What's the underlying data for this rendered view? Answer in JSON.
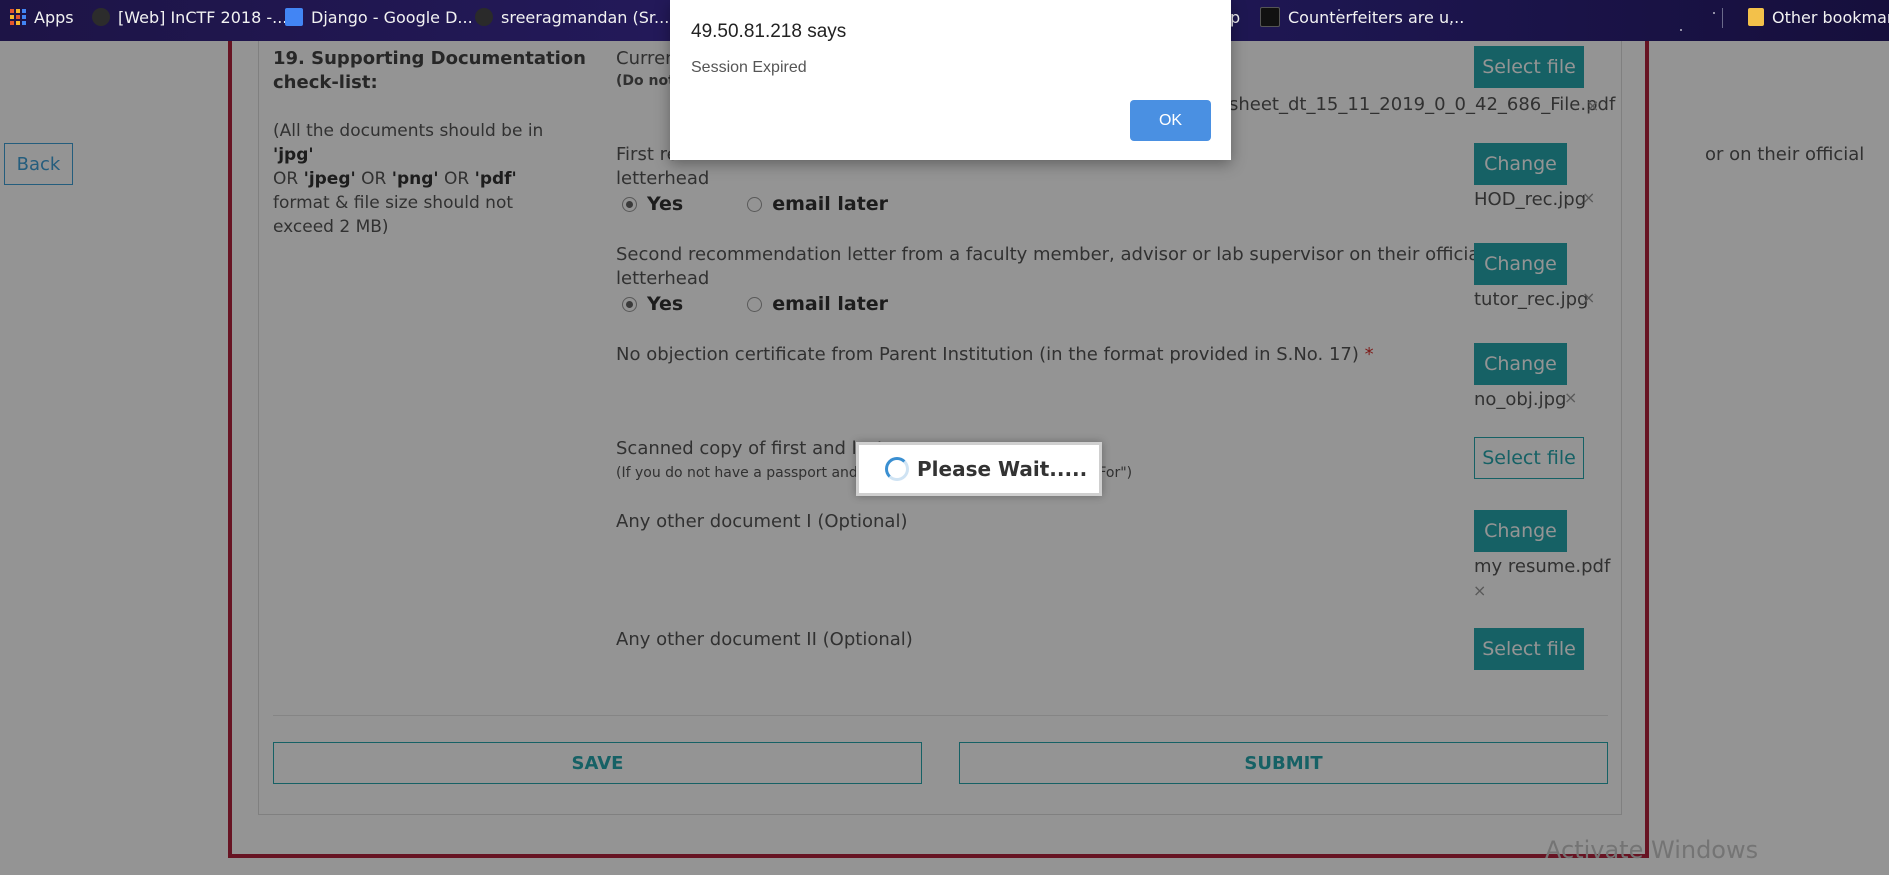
{
  "bookmarks": {
    "apps_label": "Apps",
    "items": [
      {
        "label": "[Web] InCTF 2018 -..."
      },
      {
        "label": "Django - Google D..."
      },
      {
        "label": "sreeragmandan (Sr..."
      },
      {
        "label": "p"
      },
      {
        "label": "Counterfeiters are u..."
      }
    ],
    "other_label": "Other bookmarks"
  },
  "page": {
    "back_label": "Back",
    "section_title_1": "19. Supporting Documentation",
    "section_title_2": "check-list:",
    "note": {
      "prefix": "(All the documents should be in ",
      "jpg": "'jpg'",
      "or1": "OR ",
      "jpeg": "'jpeg'",
      "or2": " OR ",
      "png": "'png'",
      "or3": " OR ",
      "pdf": "'pdf'",
      "suffix": " format & file size should not exceed 2 MB)"
    },
    "docs": {
      "d1_label": "Curren",
      "d1_sub": "(Do not",
      "d1_button": "Select file",
      "d1_file": "sheet_dt_15_11_2019_0_0_42_686_File.pdf",
      "d2_label": "First re",
      "d2_label_tail": "or on their official",
      "d2_label_2": "letterhead",
      "d2_button": "Change",
      "d2_file": "HOD_rec.jpg",
      "d3_label": "Second recommendation letter from a faculty member, advisor or lab supervisor on their official",
      "d3_label_2": "letterhead",
      "d3_button": "Change",
      "d3_file": "tutor_rec.jpg",
      "d4_label": "No objection certificate from Parent Institution (in the format provided in S.No. 17)",
      "d4_required": "*",
      "d4_button": "Change",
      "d4_file": "no_obj.jpg",
      "d5_label": "Scanned copy of first and last",
      "d5_sub": "(If you do not have a passport and",
      "d5_sub_tail": "d For\")",
      "d5_button": "Select file",
      "d6_label": "Any other document I (Optional)",
      "d6_button": "Change",
      "d6_file": "my resume.pdf",
      "d7_label": "Any other document II (Optional)",
      "d7_button": "Select file"
    },
    "radio_yes": "Yes",
    "radio_email": "email later",
    "remove_glyph": "×",
    "save_label": "SAVE",
    "submit_label": "SUBMIT",
    "watermark": "Activate Windows"
  },
  "wait_dialog": {
    "text": "Please Wait....."
  },
  "alert": {
    "host": "49.50.81.218 says",
    "message": "Session Expired",
    "ok_label": "OK"
  },
  "colors": {
    "accent": "#26a8ae",
    "frame": "#b2243d",
    "alert_button": "#4a90e2"
  }
}
